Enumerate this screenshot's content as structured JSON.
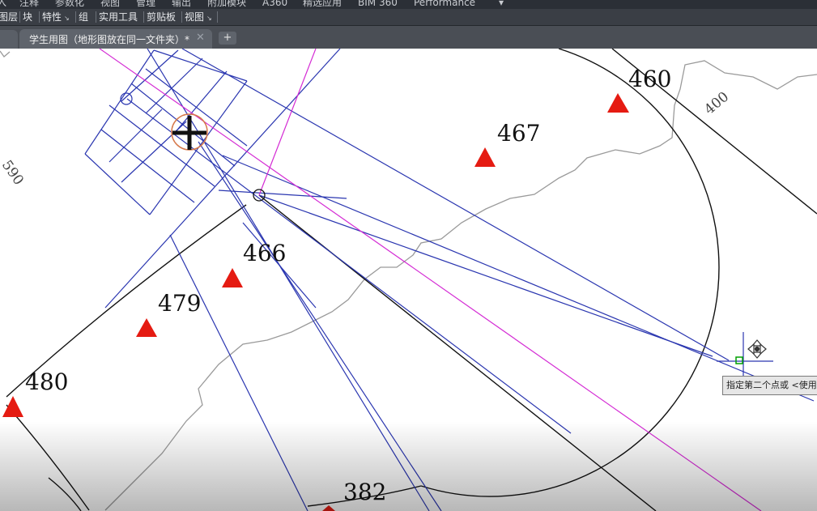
{
  "menu_items": [
    "入",
    "注释",
    "参数化",
    "视图",
    "管理",
    "输出",
    "附加模块",
    "A360",
    "精选应用",
    "BIM 360",
    "Performance"
  ],
  "ribbon_panels": [
    {
      "label": "图层",
      "dropdown": false
    },
    {
      "label": "块",
      "dropdown": false
    },
    {
      "label": "特性",
      "dropdown": true
    },
    {
      "label": "组",
      "dropdown": false
    },
    {
      "label": "实用工具",
      "dropdown": false
    },
    {
      "label": "剪贴板",
      "dropdown": false
    },
    {
      "label": "视图",
      "dropdown": true
    }
  ],
  "tab": {
    "title": "学生用图（地形图放在同一文件夹）*",
    "close_glyph": "✕",
    "add_glyph": "+"
  },
  "elevation_labels": [
    "460",
    "467",
    "466",
    "479",
    "480",
    "382",
    "400",
    "590"
  ],
  "tooltip": "指定第二个点或 <使用",
  "colors": {
    "survey_lines": "#2a36b0",
    "ray": "#d42bd4",
    "marker": "#e51b12",
    "contour": "#9a9a9a",
    "circle": "#111111",
    "snap": "#00a000"
  }
}
